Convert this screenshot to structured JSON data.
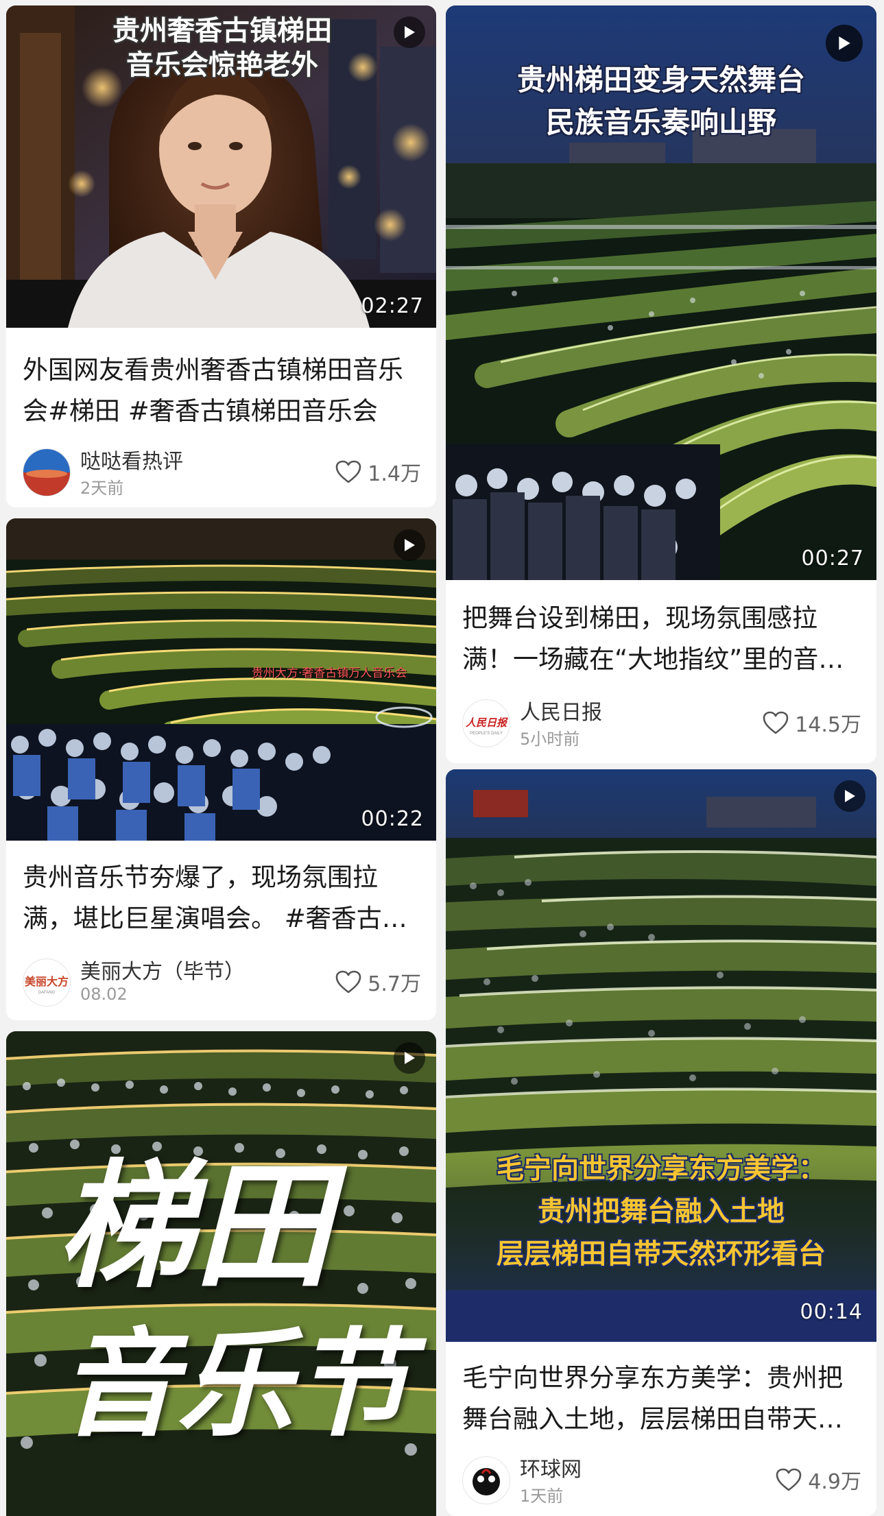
{
  "cards": [
    {
      "overlay": [
        "贵州奢香古镇梯田",
        "音乐会惊艳老外"
      ],
      "duration": "02:27",
      "title": "外国网友看贵州奢香古镇梯田音乐会#梯田 #奢香古镇梯田音乐会",
      "author": "哒哒看热评",
      "time": "2天前",
      "likes": "1.4万"
    },
    {
      "overlay": [
        "贵州梯田变身天然舞台",
        "民族音乐奏响山野"
      ],
      "duration": "00:27",
      "title": "把舞台设到梯田，现场氛围感拉满！一场藏在“大地指纹”里的音乐会",
      "author": "人民日报",
      "time": "5小时前",
      "likes": "14.5万"
    },
    {
      "overlay": [
        "贵州大方·奢香古镇万人音乐会"
      ],
      "duration": "00:22",
      "title": "贵州音乐节夯爆了，现场氛围拉满，堪比巨星演唱会。 #奢香古镇梯田音乐会",
      "author": "美丽大方（毕节）",
      "time": "08.02",
      "likes": "5.7万"
    },
    {
      "overlay": [
        "毛宁向世界分享东方美学：",
        "贵州把舞台融入土地",
        "层层梯田自带天然环形看台"
      ],
      "duration": "00:14",
      "title": "毛宁向世界分享东方美学：贵州把舞台融入土地，层层梯田自带天然环形看台",
      "author": "环球网",
      "time": "1天前",
      "likes": "4.9万"
    },
    {
      "overlay": [
        "梯田",
        "音乐节"
      ]
    }
  ],
  "colors": {
    "overlay_yellow": "#f7c531",
    "background": "#f2f2f2",
    "card": "#ffffff"
  },
  "icons": [
    "play-icon",
    "heart-icon"
  ]
}
